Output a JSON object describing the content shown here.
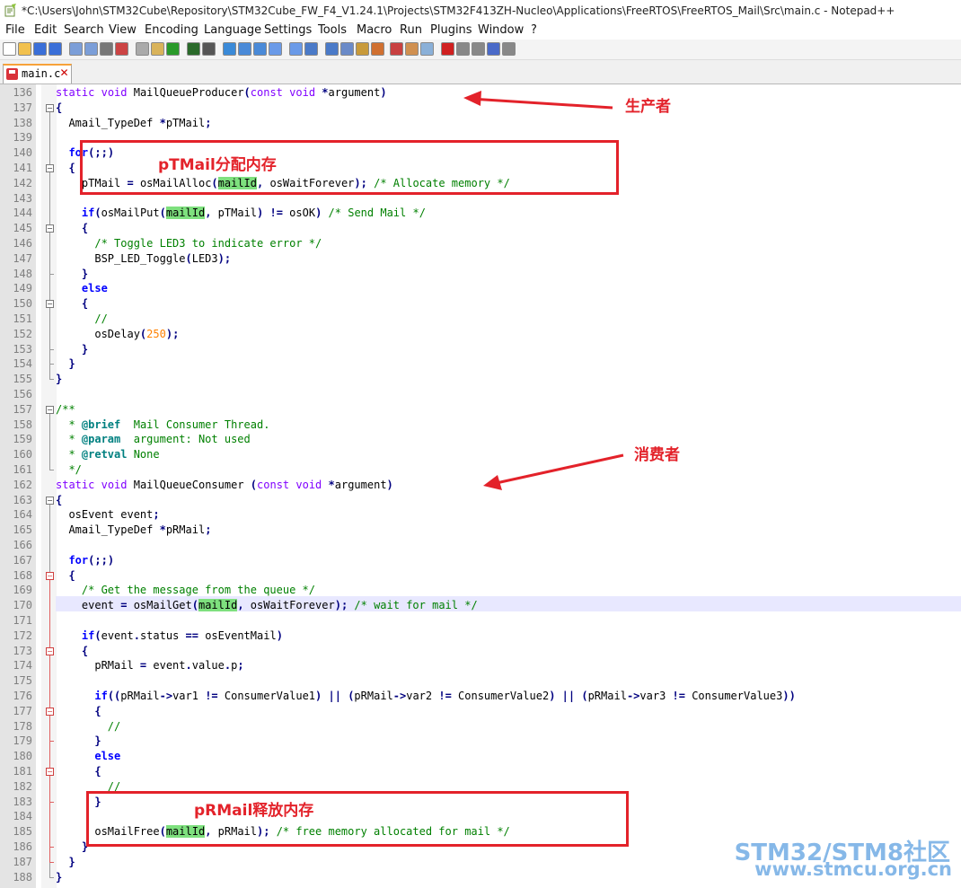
{
  "window": {
    "title": "*C:\\Users\\John\\STM32Cube\\Repository\\STM32Cube_FW_F4_V1.24.1\\Projects\\STM32F413ZH-Nucleo\\Applications\\FreeRTOS\\FreeRTOS_Mail\\Src\\main.c - Notepad++"
  },
  "menu": [
    "File",
    "Edit",
    "Search",
    "View",
    "Encoding",
    "Language",
    "Settings",
    "Tools",
    "Macro",
    "Run",
    "Plugins",
    "Window",
    "?"
  ],
  "toolbar_icons": [
    "new-file-icon",
    "open-file-icon",
    "save-icon",
    "save-all-icon",
    "close-icon",
    "close-all-icon",
    "print-icon",
    "cut-icon",
    "copy-icon",
    "paste-icon",
    "undo-icon",
    "redo-icon",
    "find-icon",
    "replace-icon",
    "zoom-in-icon",
    "zoom-out-icon",
    "sync-v-icon",
    "sync-h-icon",
    "word-wrap-icon",
    "all-chars-icon",
    "indent-guide-icon",
    "user-lang-icon",
    "doc-map-icon",
    "function-list-icon",
    "folder-workspace-icon",
    "monitor-icon",
    "record-macro-icon",
    "stop-record-icon",
    "play-macro-icon",
    "run-macro-multiple-icon",
    "save-macro-icon"
  ],
  "tab": {
    "label": "main.c",
    "close": "✕"
  },
  "lines": [
    {
      "n": "136",
      "html": "<span class='typ'>static</span> <span class='typ'>void</span> MailQueueProducer<span class='op'>(</span><span class='typ'>const</span> <span class='typ'>void</span> <span class='op'>*</span>argument<span class='op'>)</span>"
    },
    {
      "n": "137",
      "html": "<span class='op'>{</span>"
    },
    {
      "n": "138",
      "html": "  Amail_TypeDef <span class='op'>*</span>pTMail<span class='op'>;</span>"
    },
    {
      "n": "139",
      "html": ""
    },
    {
      "n": "140",
      "html": "  <span class='kw'>for</span><span class='op'>(;;)</span>"
    },
    {
      "n": "141",
      "html": "  <span class='op'>{</span>"
    },
    {
      "n": "142",
      "html": "    pTMail <span class='op'>=</span> osMailAlloc<span class='op'>(</span><span class='hl'>mailId</span><span class='op'>,</span> osWaitForever<span class='op'>);</span> <span class='cm'>/* Allocate memory */</span>"
    },
    {
      "n": "143",
      "html": ""
    },
    {
      "n": "144",
      "html": "    <span class='kw'>if</span><span class='op'>(</span>osMailPut<span class='op'>(</span><span class='hl'>mailId</span><span class='op'>,</span> pTMail<span class='op'>)</span> <span class='op'>!=</span> osOK<span class='op'>)</span> <span class='cm'>/* Send Mail */</span>"
    },
    {
      "n": "145",
      "html": "    <span class='op'>{</span>"
    },
    {
      "n": "146",
      "html": "      <span class='cm'>/* Toggle LED3 to indicate error */</span>"
    },
    {
      "n": "147",
      "html": "      BSP_LED_Toggle<span class='op'>(</span>LED3<span class='op'>);</span>"
    },
    {
      "n": "148",
      "html": "    <span class='op'>}</span>"
    },
    {
      "n": "149",
      "html": "    <span class='kw'>else</span>"
    },
    {
      "n": "150",
      "html": "    <span class='op'>{</span>"
    },
    {
      "n": "151",
      "html": "      <span class='cm'>//</span>"
    },
    {
      "n": "152",
      "html": "      osDelay<span class='op'>(</span><span class='num'>250</span><span class='op'>);</span>"
    },
    {
      "n": "153",
      "html": "    <span class='op'>}</span>"
    },
    {
      "n": "154",
      "html": "  <span class='op'>}</span>"
    },
    {
      "n": "155",
      "html": "<span class='op'>}</span>"
    },
    {
      "n": "156",
      "html": ""
    },
    {
      "n": "157",
      "html": "<span class='cm'>/**</span>"
    },
    {
      "n": "158",
      "html": "<span class='cm'>  * </span><span class='dtag'>@brief</span><span class='cm'>  Mail Consumer Thread.</span>"
    },
    {
      "n": "159",
      "html": "<span class='cm'>  * </span><span class='dtag'>@param</span><span class='cm'>  argument: Not used</span>"
    },
    {
      "n": "160",
      "html": "<span class='cm'>  * </span><span class='dtag'>@retval</span><span class='cm'> None</span>"
    },
    {
      "n": "161",
      "html": "<span class='cm'>  */</span>"
    },
    {
      "n": "162",
      "html": "<span class='typ'>static</span> <span class='typ'>void</span> MailQueueConsumer <span class='op'>(</span><span class='typ'>const</span> <span class='typ'>void</span> <span class='op'>*</span>argument<span class='op'>)</span>"
    },
    {
      "n": "163",
      "html": "<span class='op'>{</span>"
    },
    {
      "n": "164",
      "html": "  osEvent event<span class='op'>;</span>"
    },
    {
      "n": "165",
      "html": "  Amail_TypeDef <span class='op'>*</span>pRMail<span class='op'>;</span>"
    },
    {
      "n": "166",
      "html": ""
    },
    {
      "n": "167",
      "html": "  <span class='kw'>for</span><span class='op'>(;;)</span>"
    },
    {
      "n": "168",
      "html": "  <span class='op'>{</span>"
    },
    {
      "n": "169",
      "html": "    <span class='cm'>/* Get the message from the queue */</span>"
    },
    {
      "n": "170",
      "html": "    event <span class='op'>=</span> osMailGet<span class='op'>(</span><span class='hl'>mailId</span><span class='op'>,</span> osWaitForever<span class='op'>);</span> <span class='cm'>/* wait for mail */</span>"
    },
    {
      "n": "171",
      "html": ""
    },
    {
      "n": "172",
      "html": "    <span class='kw'>if</span><span class='op'>(</span>event<span class='op'>.</span>status <span class='op'>==</span> osEventMail<span class='op'>)</span>"
    },
    {
      "n": "173",
      "html": "    <span class='op'>{</span>"
    },
    {
      "n": "174",
      "html": "      pRMail <span class='op'>=</span> event<span class='op'>.</span>value<span class='op'>.</span>p<span class='op'>;</span>"
    },
    {
      "n": "175",
      "html": ""
    },
    {
      "n": "176",
      "html": "      <span class='kw'>if</span><span class='op'>((</span>pRMail<span class='op'>-&gt;</span>var1 <span class='op'>!=</span> ConsumerValue1<span class='op'>)</span> <span class='op'>||</span> <span class='op'>(</span>pRMail<span class='op'>-&gt;</span>var2 <span class='op'>!=</span> ConsumerValue2<span class='op'>)</span> <span class='op'>||</span> <span class='op'>(</span>pRMail<span class='op'>-&gt;</span>var3 <span class='op'>!=</span> ConsumerValue3<span class='op'>))</span>"
    },
    {
      "n": "177",
      "html": "      <span class='op'>{</span>"
    },
    {
      "n": "178",
      "html": "        <span class='cm'>//</span>"
    },
    {
      "n": "179",
      "html": "      <span class='op'>}</span>"
    },
    {
      "n": "180",
      "html": "      <span class='kw'>else</span>"
    },
    {
      "n": "181",
      "html": "      <span class='op'>{</span>"
    },
    {
      "n": "182",
      "html": "        <span class='cm'>//</span>"
    },
    {
      "n": "183",
      "html": "      <span class='op'>}</span>"
    },
    {
      "n": "184",
      "html": ""
    },
    {
      "n": "185",
      "html": "      osMailFree<span class='op'>(</span><span class='hl'>mailId</span><span class='op'>,</span> pRMail<span class='op'>);</span> <span class='cm'>/* free memory allocated for mail */</span>"
    },
    {
      "n": "186",
      "html": "    <span class='op'>}</span>"
    },
    {
      "n": "187",
      "html": "  <span class='op'>}</span>"
    },
    {
      "n": "188",
      "html": "<span class='op'>}</span>"
    }
  ],
  "annotations": {
    "producer": "生产者",
    "consumer": "消费者",
    "alloc": "pTMail分配内存",
    "free": "pRMail释放内存"
  },
  "watermark": {
    "line1": "STM32/STM8社区",
    "line2": "www.stmcu.org.cn"
  }
}
